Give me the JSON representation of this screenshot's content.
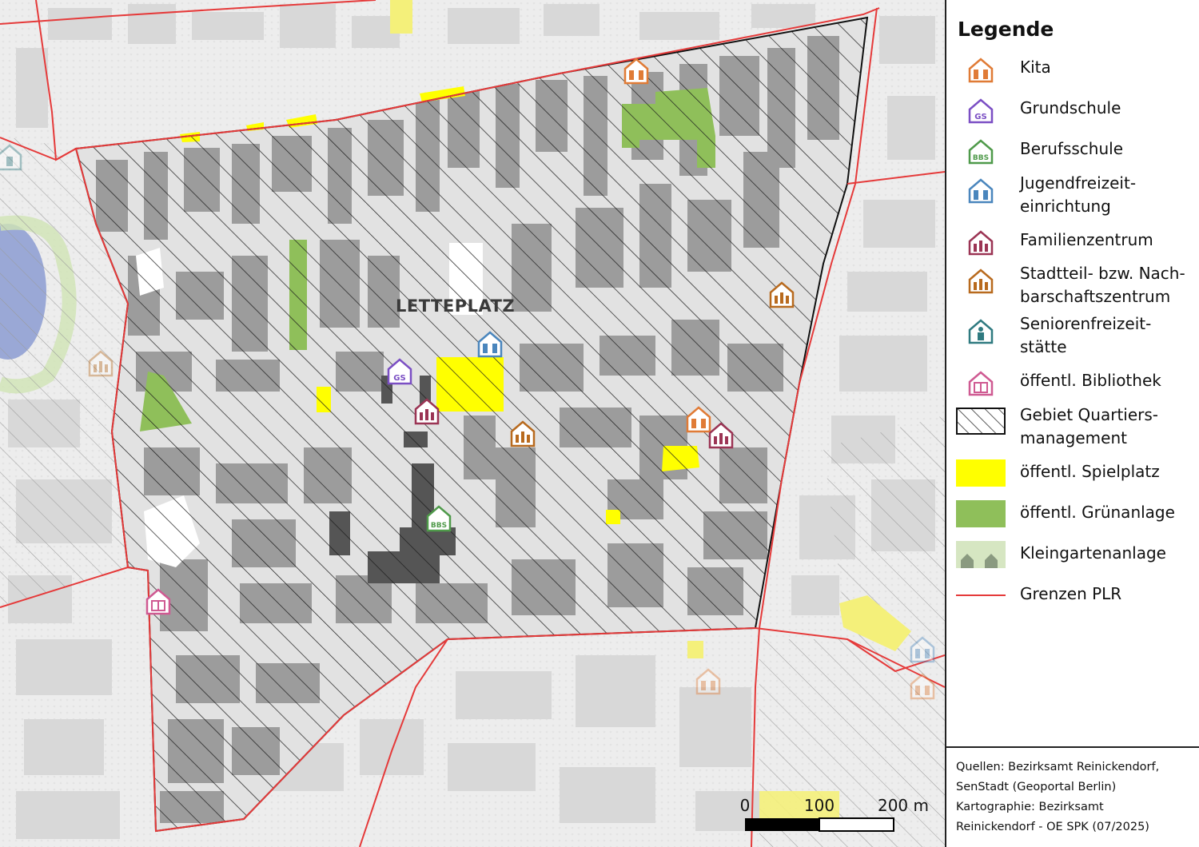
{
  "map": {
    "district_label": "LETTEPLATZ",
    "scale_bar": {
      "ticks": [
        "0",
        "100",
        "200 m"
      ]
    }
  },
  "legend": {
    "title": "Legende",
    "items": [
      {
        "label": "Kita",
        "icon": "kita-icon",
        "color": "#e07b36"
      },
      {
        "label": "Grundschule",
        "icon": "grundschule-icon",
        "color": "#7b4fc4"
      },
      {
        "label": "Berufsschule",
        "icon": "berufsschule-icon",
        "color": "#4f9a4a"
      },
      {
        "label": "Jugendfreizeit-\neinrichtung",
        "icon": "jugendfreizeit-icon",
        "color": "#4a86bd"
      },
      {
        "label": "Familienzentrum",
        "icon": "familienzentrum-icon",
        "color": "#9b3454"
      },
      {
        "label": "Stadtteil- bzw. Nach-\nbarschaftszentrum",
        "icon": "stadtteilzentrum-icon",
        "color": "#b86a1e"
      },
      {
        "label": "Seniorenfreizeit-\nstätte",
        "icon": "seniorenfreizeit-icon",
        "color": "#2f7a80"
      },
      {
        "label": "öffentl. Bibliothek",
        "icon": "bibliothek-icon",
        "color": "#cf5a92"
      },
      {
        "label": "Gebiet Quartiers-\nmanagement",
        "icon": "hatched-area-swatch",
        "color": "#222222"
      },
      {
        "label": "öffentl. Spielplatz",
        "icon": "playground-swatch",
        "color": "#ffff00"
      },
      {
        "label": "öffentl. Grünanlage",
        "icon": "green-space-swatch",
        "color": "#8fbf5a"
      },
      {
        "label": "Kleingartenanlage",
        "icon": "allotment-swatch",
        "color": "#d6e6c2"
      },
      {
        "label": "Grenzen PLR",
        "icon": "boundary-line-swatch",
        "color": "#e53a3a"
      }
    ]
  },
  "sources": "Quellen: Bezirksamt Reinickendorf,\nSenStadt (Geoportal Berlin)\nKartographie: Bezirksamt\nReinickendorf - OE SPK (07/2025)"
}
